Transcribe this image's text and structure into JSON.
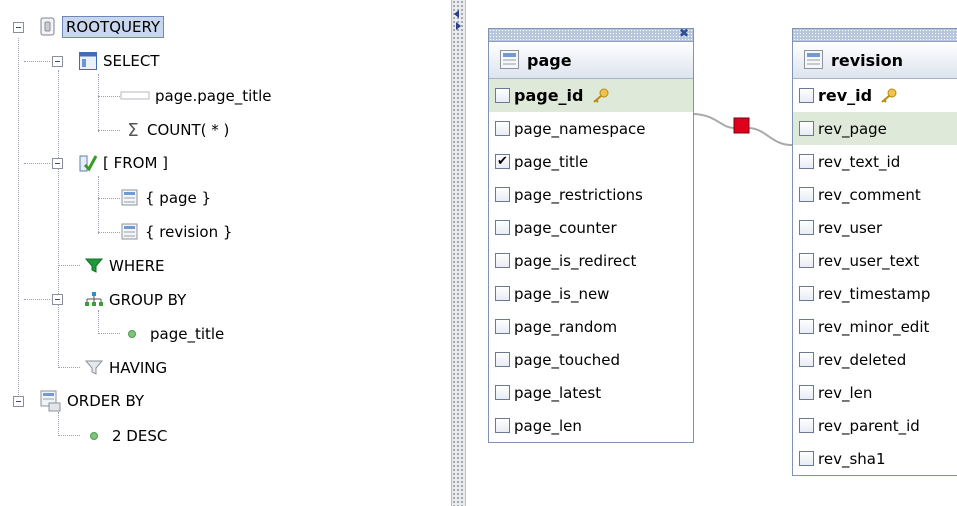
{
  "tree": {
    "root": "ROOTQUERY",
    "select": {
      "label": "SELECT",
      "items": [
        "page.page_title",
        "COUNT( * )"
      ]
    },
    "from": {
      "label": "[ FROM ]",
      "items": [
        "{ page }",
        "{ revision }"
      ]
    },
    "where": "WHERE",
    "group_by": {
      "label": "GROUP BY",
      "items": [
        "page_title"
      ]
    },
    "having": "HAVING",
    "order_by": {
      "label": "ORDER BY",
      "items": [
        "2 DESC"
      ]
    }
  },
  "diagram": {
    "join_color": "#e0001b",
    "tables": [
      {
        "name": "page",
        "columns": [
          {
            "name": "page_id",
            "key": true,
            "checked": false,
            "highlight": true
          },
          {
            "name": "page_namespace",
            "checked": false
          },
          {
            "name": "page_title",
            "checked": true
          },
          {
            "name": "page_restrictions",
            "checked": false
          },
          {
            "name": "page_counter",
            "checked": false
          },
          {
            "name": "page_is_redirect",
            "checked": false
          },
          {
            "name": "page_is_new",
            "checked": false
          },
          {
            "name": "page_random",
            "checked": false
          },
          {
            "name": "page_touched",
            "checked": false
          },
          {
            "name": "page_latest",
            "checked": false
          },
          {
            "name": "page_len",
            "checked": false
          }
        ]
      },
      {
        "name": "revision",
        "columns": [
          {
            "name": "rev_id",
            "key": true,
            "checked": false
          },
          {
            "name": "rev_page",
            "checked": false,
            "highlight": true
          },
          {
            "name": "rev_text_id",
            "checked": false
          },
          {
            "name": "rev_comment",
            "checked": false
          },
          {
            "name": "rev_user",
            "checked": false
          },
          {
            "name": "rev_user_text",
            "checked": false
          },
          {
            "name": "rev_timestamp",
            "checked": false
          },
          {
            "name": "rev_minor_edit",
            "checked": false
          },
          {
            "name": "rev_deleted",
            "checked": false
          },
          {
            "name": "rev_len",
            "checked": false
          },
          {
            "name": "rev_parent_id",
            "checked": false
          },
          {
            "name": "rev_sha1",
            "checked": false
          }
        ]
      }
    ]
  }
}
